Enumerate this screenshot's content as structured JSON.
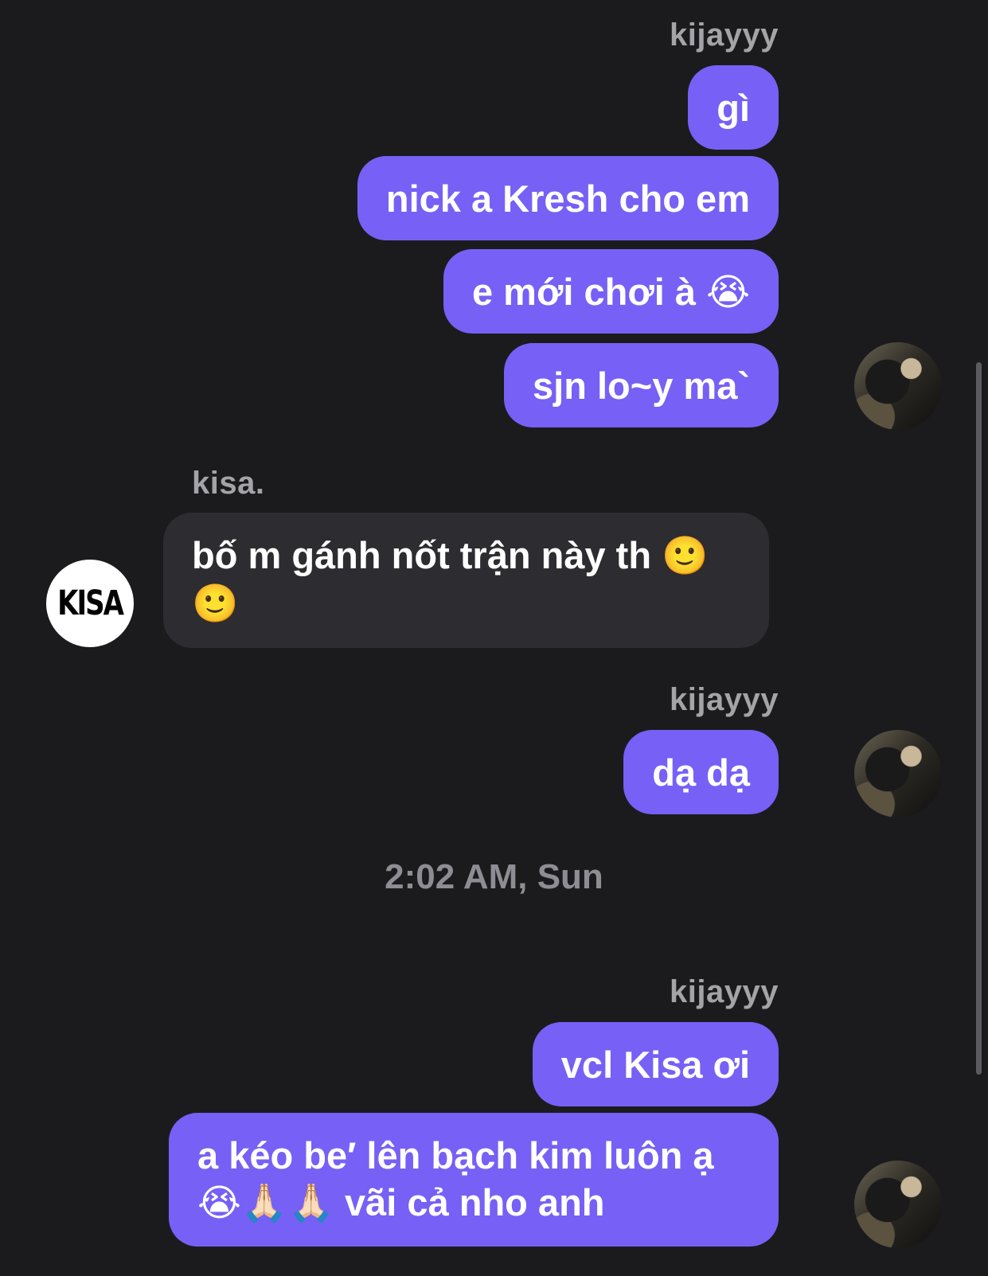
{
  "conversation": {
    "group1": {
      "sender": "kijayyy",
      "messages": [
        "gì",
        "nick a Kresh cho em",
        "e mới chơi à 😭",
        "sjn lo~y ma`"
      ]
    },
    "group2": {
      "sender": "kisa.",
      "avatar_text": "KISA",
      "message": "bố m gánh nốt trận này th 🙂 🙂"
    },
    "group3": {
      "sender": "kijayyy",
      "message": "dạ dạ"
    },
    "timestamp": "2:02 AM, Sun",
    "group4": {
      "sender": "kijayyy",
      "messages": [
        "vcl Kisa ơi",
        "a kéo be′ lên bạch kim luôn ạ 😭🙏🏻🙏🏻 vãi cả nho anh"
      ]
    }
  },
  "colors": {
    "background": "#1b1b1e",
    "outgoing_bubble": "#7760f5",
    "incoming_bubble": "#2d2c31",
    "sender_name": "#a3a3a8",
    "timestamp": "#8d8d93"
  },
  "icons": {
    "my_avatar": "user-photo-avatar",
    "kisa_avatar": "kisa-logo-avatar"
  }
}
